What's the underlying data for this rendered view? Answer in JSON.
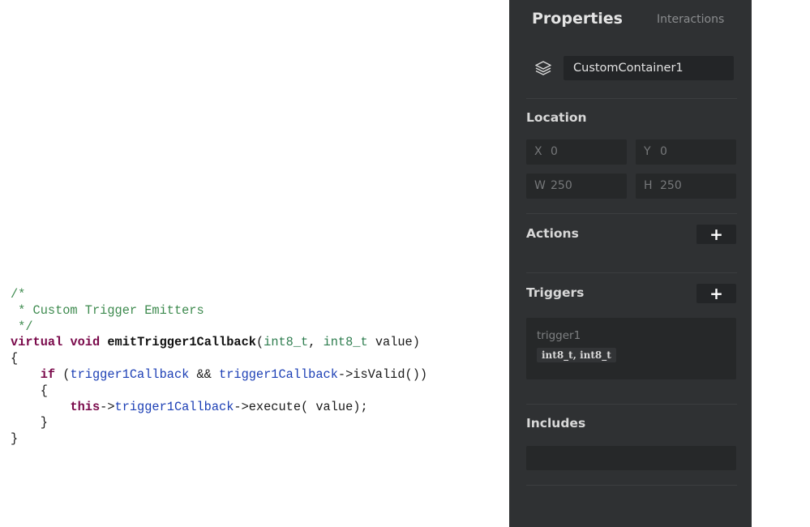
{
  "code": {
    "lines": [
      [
        {
          "t": "/*",
          "c": "comment"
        }
      ],
      [
        {
          "t": " * Custom Trigger Emitters",
          "c": "comment"
        }
      ],
      [
        {
          "t": " */",
          "c": "comment"
        }
      ],
      [
        {
          "t": "virtual",
          "c": "kw"
        },
        {
          "t": " ",
          "c": "plain"
        },
        {
          "t": "void",
          "c": "kw"
        },
        {
          "t": " ",
          "c": "plain"
        },
        {
          "t": "emitTrigger1Callback",
          "c": "fn"
        },
        {
          "t": "(",
          "c": "plain"
        },
        {
          "t": "int8_t",
          "c": "type"
        },
        {
          "t": ", ",
          "c": "plain"
        },
        {
          "t": "int8_t",
          "c": "type"
        },
        {
          "t": " value)",
          "c": "plain"
        }
      ],
      [
        {
          "t": "{",
          "c": "plain"
        }
      ],
      [
        {
          "t": "    ",
          "c": "plain"
        },
        {
          "t": "if",
          "c": "kw"
        },
        {
          "t": " (",
          "c": "plain"
        },
        {
          "t": "trigger1Callback",
          "c": "ident"
        },
        {
          "t": " && ",
          "c": "plain"
        },
        {
          "t": "trigger1Callback",
          "c": "ident"
        },
        {
          "t": "->isValid())",
          "c": "plain"
        }
      ],
      [
        {
          "t": "    {",
          "c": "plain"
        }
      ],
      [
        {
          "t": "        ",
          "c": "plain"
        },
        {
          "t": "this",
          "c": "kw"
        },
        {
          "t": "->",
          "c": "plain"
        },
        {
          "t": "trigger1Callback",
          "c": "ident"
        },
        {
          "t": "->execute( value);",
          "c": "plain"
        }
      ],
      [
        {
          "t": "    }",
          "c": "plain"
        }
      ],
      [
        {
          "t": "}",
          "c": "plain"
        }
      ]
    ]
  },
  "panel": {
    "tabs": {
      "properties": "Properties",
      "interactions": "Interactions"
    },
    "name_value": "CustomContainer1",
    "icons": {
      "layers": "layers-icon",
      "add": "plus-icon"
    },
    "location": {
      "title": "Location",
      "x_label": "X",
      "x_value": "0",
      "y_label": "Y",
      "y_value": "0",
      "w_label": "W",
      "w_value": "250",
      "h_label": "H",
      "h_value": "250"
    },
    "actions": {
      "title": "Actions",
      "add_label": "+"
    },
    "triggers": {
      "title": "Triggers",
      "add_label": "+",
      "items": [
        {
          "name": "trigger1",
          "args": "int8_t, int8_t"
        }
      ]
    },
    "includes": {
      "title": "Includes",
      "value": ""
    }
  },
  "colors": {
    "panel_bg": "#2f3133",
    "field_bg": "#262829",
    "comment": "#3d8a4e",
    "keyword": "#7a0a4b",
    "identifier": "#1c3fb5",
    "type": "#2e7d4f"
  }
}
